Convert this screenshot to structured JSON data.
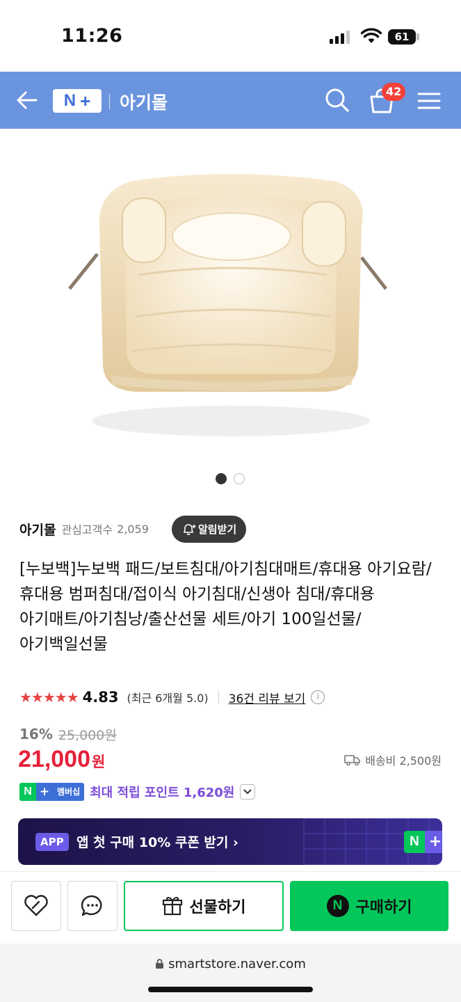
{
  "status_bar": {
    "time": "11:26",
    "battery": "61"
  },
  "header": {
    "title": "아기몰",
    "cart_count": "42",
    "logo_n": "N",
    "logo_plus": "+"
  },
  "carousel": {
    "current": 1,
    "total": 2
  },
  "store": {
    "name": "아기몰",
    "fans_label": "관심고객수",
    "fans_count": "2,059",
    "alarm_label": "알림받기"
  },
  "product": {
    "title": "[누보백]누보백 패드/보트침대/아기침대매트/휴대용 아기요람/휴대용 범퍼침대/접이식 아기침대/신생아 침대/휴대용 아기매트/아기침낭/출산선물 세트/아기 100일선물/아기백일선물",
    "stars": "★★★★★",
    "rating": "4.83",
    "rating_recent": "(최근 6개월 5.0)",
    "review_link": "36건 리뷰 보기",
    "discount_rate": "16%",
    "original_price": "25,000원",
    "sale_price": "21,000",
    "sale_unit": "원",
    "shipping": "배송비 2,500원"
  },
  "membership": {
    "badge_n": "N",
    "badge_plus": "+",
    "badge_label": "멤버십",
    "text": "최대 적립 포인트 1,620원"
  },
  "app_banner": {
    "tag": "APP",
    "text": "앱 첫 구매 10% 쿠폰 받기 ›",
    "logo_n": "N",
    "logo_plus": "+"
  },
  "actions": {
    "gift_label": "선물하기",
    "buy_label": "구매하기",
    "buy_n": "N"
  },
  "browser": {
    "url": "smartstore.naver.com"
  },
  "colors": {
    "header_bg": "#6b94de",
    "sale_red": "#e6213b",
    "naver_green": "#03c75a",
    "member_purple": "#7a4bd8",
    "banner_bg": "#1e1348"
  }
}
